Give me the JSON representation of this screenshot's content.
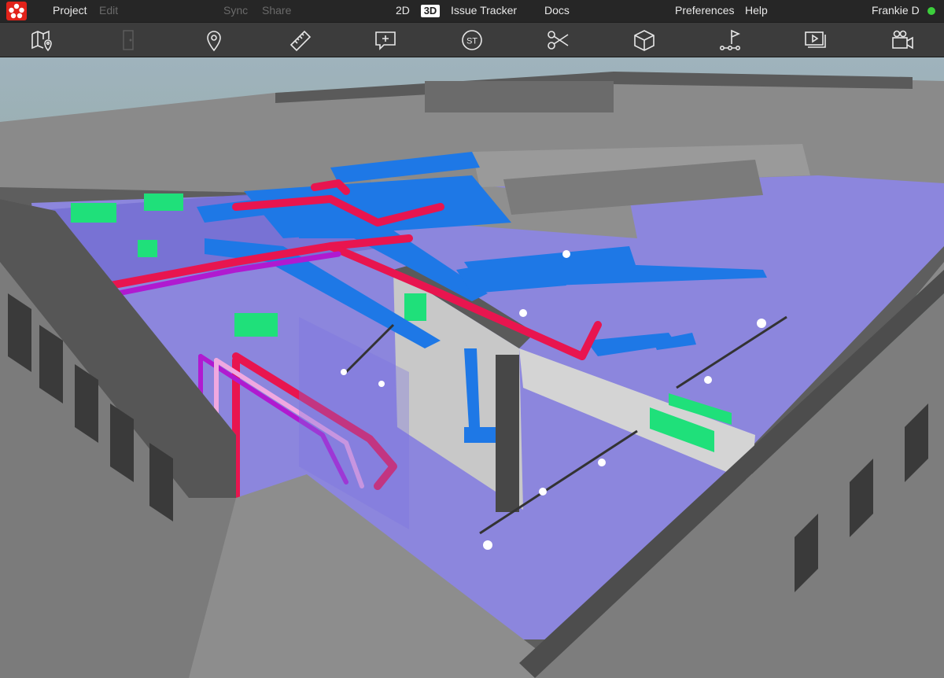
{
  "app": {
    "name": "Project",
    "colors": {
      "logo": "#e2231a",
      "status_online": "#3ccf3c",
      "menu_bg": "#262626",
      "toolbar_bg": "#3c3c3c"
    }
  },
  "menubar": {
    "project_label": "Project",
    "edit_label": "Edit",
    "sync_label": "Sync",
    "share_label": "Share",
    "view_2d_label": "2D",
    "view_3d_label": "3D",
    "issue_tracker_label": "Issue Tracker",
    "docs_label": "Docs",
    "preferences_label": "Preferences",
    "help_label": "Help",
    "user_name": "Frankie D"
  },
  "toolbar": {
    "tools": [
      {
        "name": "map-pin-icon",
        "enabled": true
      },
      {
        "name": "door-icon",
        "enabled": false
      },
      {
        "name": "location-pin-icon",
        "enabled": true
      },
      {
        "name": "ruler-icon",
        "enabled": true
      },
      {
        "name": "add-comment-icon",
        "enabled": true
      },
      {
        "name": "st-badge-icon",
        "enabled": true,
        "label": "ST"
      },
      {
        "name": "scissors-icon",
        "enabled": true
      },
      {
        "name": "cube-icon",
        "enabled": true
      },
      {
        "name": "flag-path-icon",
        "enabled": true
      },
      {
        "name": "slides-icon",
        "enabled": true
      },
      {
        "name": "video-camera-icon",
        "enabled": true
      }
    ]
  },
  "viewport": {
    "description_colors": {
      "ducts": "#1e78e6",
      "pipes_red": "#e8154f",
      "pipes_purple": "#b01ad0",
      "pipes_pink": "#f0a8e0",
      "equipment": "#1fe07a",
      "floor": "#8a86df",
      "walls": "#7a7a7a"
    }
  }
}
